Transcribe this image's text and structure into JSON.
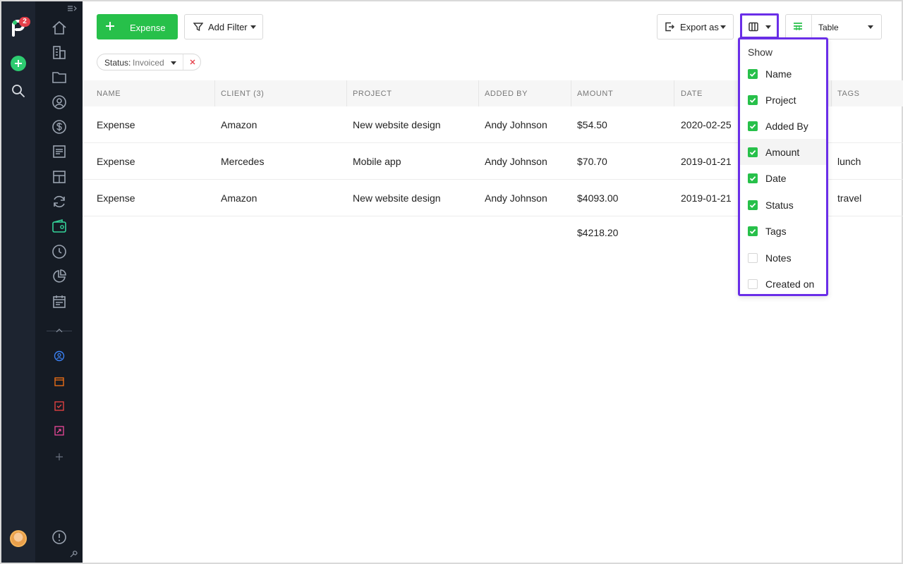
{
  "app": {
    "notification_count": "2"
  },
  "toolbar": {
    "add_expense_label": "Expense",
    "add_filter_label": "Add Filter",
    "export_label": "Export as",
    "view_label": "Table"
  },
  "filter_chip": {
    "key": "Status:",
    "value": "Invoiced"
  },
  "table": {
    "columns": [
      "Name",
      "Client (3)",
      "Project",
      "Added By",
      "Amount",
      "Date",
      "Tags"
    ],
    "rows": [
      {
        "name": "Expense",
        "client": "Amazon",
        "project": "New website design",
        "added_by": "Andy Johnson",
        "amount": "$54.50",
        "date": "2020-02-25",
        "tags": ""
      },
      {
        "name": "Expense",
        "client": "Mercedes",
        "project": "Mobile app",
        "added_by": "Andy Johnson",
        "amount": "$70.70",
        "date": "2019-01-21",
        "tags": "lunch"
      },
      {
        "name": "Expense",
        "client": "Amazon",
        "project": "New website design",
        "added_by": "Andy Johnson",
        "amount": "$4093.00",
        "date": "2019-01-21",
        "tags": "travel"
      }
    ],
    "total_amount": "$4218.20"
  },
  "columns_menu": {
    "title": "Show",
    "options": [
      {
        "label": "Name",
        "checked": true
      },
      {
        "label": "Project",
        "checked": true
      },
      {
        "label": "Added By",
        "checked": true
      },
      {
        "label": "Amount",
        "checked": true
      },
      {
        "label": "Date",
        "checked": true
      },
      {
        "label": "Status",
        "checked": true
      },
      {
        "label": "Tags",
        "checked": true
      },
      {
        "label": "Notes",
        "checked": false
      },
      {
        "label": "Created on",
        "checked": false
      }
    ]
  },
  "colors": {
    "primary_green": "#27c04a",
    "highlight_purple": "#6a2ee8",
    "rail_bg": "#1d2430",
    "sidebar_bg": "#151b24",
    "badge_red": "#e6404a"
  },
  "icons": {
    "rail": [
      "logo-icon",
      "plus-icon",
      "search-icon"
    ],
    "sidebar_nav": [
      "home-icon",
      "building-icon",
      "folder-icon",
      "user-circle-icon",
      "dollar-icon",
      "document-list-icon",
      "layout-icon",
      "refresh-icon",
      "wallet-icon",
      "clock-icon",
      "pie-chart-icon",
      "calendar-icon"
    ],
    "sidebar_apps": [
      "contacts-app-icon",
      "calendar-app-icon",
      "tasks-app-icon",
      "reports-app-icon"
    ]
  }
}
